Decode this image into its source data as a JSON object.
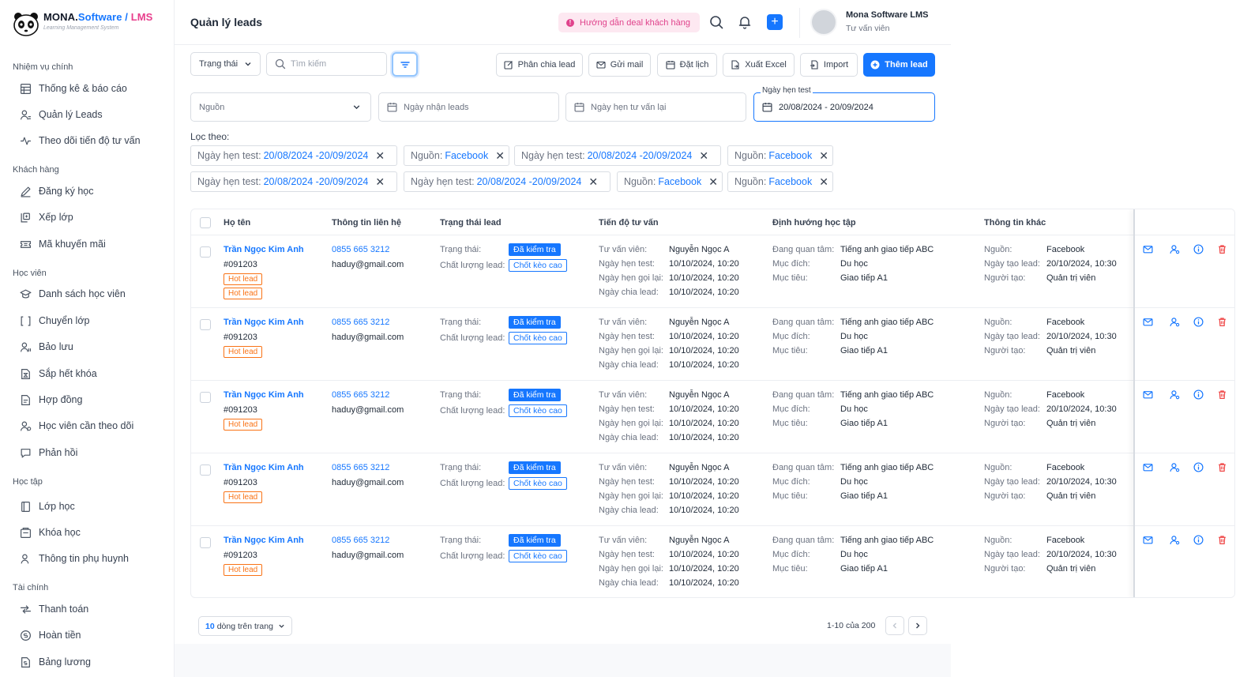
{
  "app": {
    "brand_main": "MONA.",
    "brand_software": "Software",
    "brand_sep": " / ",
    "brand_lms": "LMS",
    "brand_sub": "Learning Management System"
  },
  "sidebar": {
    "sections": [
      {
        "title": "Nhiệm vụ chính",
        "items": [
          {
            "label": "Thống kê & báo cáo",
            "icon": "table-icon"
          },
          {
            "label": "Quản lý Leads",
            "icon": "user-list-icon"
          },
          {
            "label": "Theo dõi tiến độ tư vấn",
            "icon": "activity-icon"
          }
        ]
      },
      {
        "title": "Khách hàng",
        "items": [
          {
            "label": "Đăng ký học",
            "icon": "pen-icon"
          },
          {
            "label": "Xếp lớp",
            "icon": "class-arrange-icon"
          },
          {
            "label": "Mã khuyến mãi",
            "icon": "ticket-icon"
          }
        ]
      },
      {
        "title": "Học viên",
        "items": [
          {
            "label": "Danh sách học viên",
            "icon": "graduation-icon"
          },
          {
            "label": "Chuyển lớp",
            "icon": "transfer-icon"
          },
          {
            "label": "Bảo lưu",
            "icon": "user-pause-icon"
          },
          {
            "label": "Sắp hết khóa",
            "icon": "hourglass-doc-icon"
          },
          {
            "label": "Hợp đồng",
            "icon": "contract-icon"
          },
          {
            "label": "Học viên cần theo dõi",
            "icon": "user-watch-icon"
          },
          {
            "label": "Phản hồi",
            "icon": "feedback-icon"
          }
        ]
      },
      {
        "title": "Học tập",
        "items": [
          {
            "label": "Lớp học",
            "icon": "book-icon"
          },
          {
            "label": "Khóa học",
            "icon": "course-icon"
          },
          {
            "label": "Thông tin phụ huynh",
            "icon": "parent-icon"
          }
        ]
      },
      {
        "title": "Tài chính",
        "items": [
          {
            "label": "Thanh toán",
            "icon": "payment-icon"
          },
          {
            "label": "Hoàn tiền",
            "icon": "refund-icon"
          },
          {
            "label": "Bảng lương",
            "icon": "salary-icon"
          }
        ]
      }
    ]
  },
  "header": {
    "title": "Quản lý leads",
    "guide_label": "Hướng dẫn deal khách hàng",
    "user_name": "Mona Software LMS",
    "user_role": "Tư vấn viên"
  },
  "toolbar": {
    "status_select": "Trạng thái",
    "search_placeholder": "Tìm kiếm",
    "assign_label": "Phân chia lead",
    "email_label": "Gửi mail",
    "schedule_label": "Đặt lịch",
    "export_label": "Xuất Excel",
    "import_label": "Import",
    "add_label": "Thêm lead"
  },
  "filters": {
    "source_placeholder": "Nguồn",
    "received_date_placeholder": "Ngày nhận leads",
    "callback_date_placeholder": "Ngày hẹn tư vấn lại",
    "test_date_label": "Ngày hẹn test",
    "test_date_value": "20/08/2024 - 20/09/2024",
    "filter_by_label": "Lọc theo:",
    "chips": [
      {
        "key": "Ngày hẹn test:",
        "value": "20/08/2024 -20/09/2024"
      },
      {
        "key": "Nguồn:",
        "value": "Facebook"
      },
      {
        "key": "Ngày hẹn test:",
        "value": "20/08/2024 -20/09/2024"
      },
      {
        "key": "Nguồn:",
        "value": "Facebook"
      },
      {
        "key": "Ngày hẹn test:",
        "value": "20/08/2024 -20/09/2024"
      },
      {
        "key": "Ngày hẹn test:",
        "value": "20/08/2024 -20/09/2024"
      },
      {
        "key": "Nguồn:",
        "value": "Facebook"
      },
      {
        "key": "Nguồn:",
        "value": "Facebook"
      }
    ]
  },
  "table": {
    "columns": [
      "Họ tên",
      "Thông tin liên hệ",
      "Trạng thái lead",
      "Tiến độ tư vấn",
      "Định hướng học tập",
      "Thông tin khác"
    ],
    "labels": {
      "status": "Trạng thái:",
      "quality": "Chất lượng lead:",
      "consultant": "Tư vấn viên:",
      "test_date": "Ngày hẹn test:",
      "call_date": "Ngày hẹn gọi lại:",
      "assign_date": "Ngày chia lead:",
      "interest": "Đang quan tâm:",
      "purpose": "Mục đích:",
      "goal": "Mục tiêu:",
      "source": "Nguồn:",
      "created_date": "Ngày tạo lead:",
      "creator": "Người tạo:"
    },
    "rows": [
      {
        "name": "Trần Ngọc Kim Anh",
        "code": "#091203",
        "tags": [
          "Hot lead",
          "Hot lead"
        ],
        "phone": "0855 665 3212",
        "email": "haduy@gmail.com",
        "status": "Đã kiểm tra",
        "quality": "Chốt kèo cao",
        "consultant": "Nguyễn Ngọc A",
        "test_date": "10/10/2024, 10:20",
        "call_date": "10/10/2024, 10:20",
        "assign_date": "10/10/2024, 10:20",
        "interest": "Tiếng anh giao tiếp ABC",
        "purpose": "Du học",
        "goal": "Giao tiếp A1",
        "source": "Facebook",
        "created_date": "20/10/2024, 10:30",
        "creator": "Quản trị viên"
      },
      {
        "name": "Trần Ngọc Kim Anh",
        "code": "#091203",
        "tags": [
          "Hot lead"
        ],
        "phone": "0855 665 3212",
        "email": "haduy@gmail.com",
        "status": "Đã kiểm tra",
        "quality": "Chốt kèo cao",
        "consultant": "Nguyễn Ngọc A",
        "test_date": "10/10/2024, 10:20",
        "call_date": "10/10/2024, 10:20",
        "assign_date": "10/10/2024, 10:20",
        "interest": "Tiếng anh giao tiếp ABC",
        "purpose": "Du học",
        "goal": "Giao tiếp A1",
        "source": "Facebook",
        "created_date": "20/10/2024, 10:30",
        "creator": "Quản trị viên"
      },
      {
        "name": "Trần Ngọc Kim Anh",
        "code": "#091203",
        "tags": [
          "Hot lead"
        ],
        "phone": "0855 665 3212",
        "email": "haduy@gmail.com",
        "status": "Đã kiểm tra",
        "quality": "Chốt kèo cao",
        "consultant": "Nguyễn Ngọc A",
        "test_date": "10/10/2024, 10:20",
        "call_date": "10/10/2024, 10:20",
        "assign_date": "10/10/2024, 10:20",
        "interest": "Tiếng anh giao tiếp ABC",
        "purpose": "Du học",
        "goal": "Giao tiếp A1",
        "source": "Facebook",
        "created_date": "20/10/2024, 10:30",
        "creator": "Quản trị viên"
      },
      {
        "name": "Trần Ngọc Kim Anh",
        "code": "#091203",
        "tags": [
          "Hot lead"
        ],
        "phone": "0855 665 3212",
        "email": "haduy@gmail.com",
        "status": "Đã kiểm tra",
        "quality": "Chốt kèo cao",
        "consultant": "Nguyễn Ngọc A",
        "test_date": "10/10/2024, 10:20",
        "call_date": "10/10/2024, 10:20",
        "assign_date": "10/10/2024, 10:20",
        "interest": "Tiếng anh giao tiếp ABC",
        "purpose": "Du học",
        "goal": "Giao tiếp A1",
        "source": "Facebook",
        "created_date": "20/10/2024, 10:30",
        "creator": "Quản trị viên"
      },
      {
        "name": "Trần Ngọc Kim Anh",
        "code": "#091203",
        "tags": [
          "Hot lead"
        ],
        "phone": "0855 665 3212",
        "email": "haduy@gmail.com",
        "status": "Đã kiểm tra",
        "quality": "Chốt kèo cao",
        "consultant": "Nguyễn Ngọc A",
        "test_date": "10/10/2024, 10:20",
        "call_date": "10/10/2024, 10:20",
        "assign_date": "10/10/2024, 10:20",
        "interest": "Tiếng anh giao tiếp ABC",
        "purpose": "Du học",
        "goal": "Giao tiếp A1",
        "source": "Facebook",
        "created_date": "20/10/2024, 10:30",
        "creator": "Quản trị viên"
      }
    ]
  },
  "pagination": {
    "page_size_num": "10",
    "page_size_text": "dòng trên trang",
    "range": "1-10",
    "of_text": "của",
    "total": "200"
  },
  "colors": {
    "primary": "#1677ff",
    "hot": "#f97316",
    "danger": "#ef4444",
    "pink": "#e0438c"
  }
}
